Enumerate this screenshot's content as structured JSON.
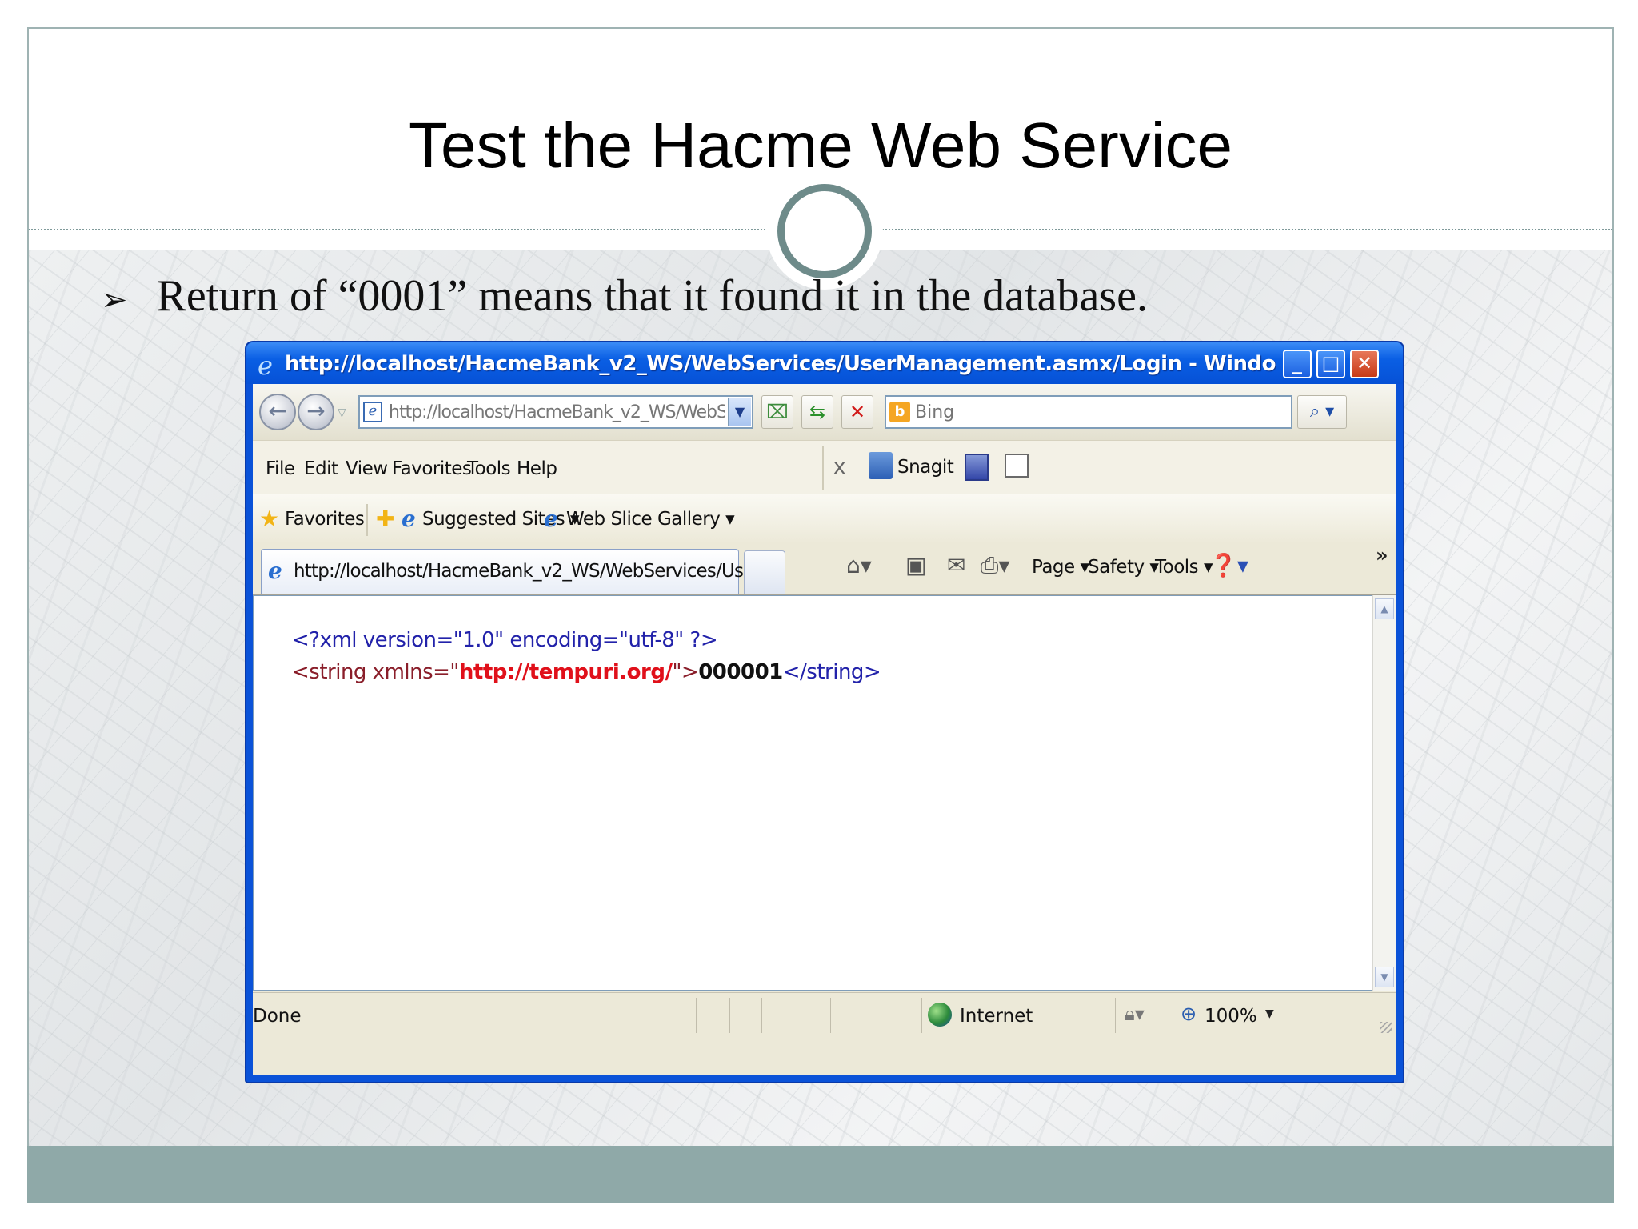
{
  "slide": {
    "title": "Test the Hacme Web Service",
    "bullet": "Return of “0001” means that it found it in the database.",
    "colors": {
      "accent": "#6e8b8a",
      "footer": "#8fa9a8"
    }
  },
  "browser": {
    "window_title": "http://localhost/HacmeBank_v2_WS/WebServices/UserManagement.asmx/Login - Windows Interne...",
    "address": "http://localhost/HacmeBank_v2_WS/WebS",
    "search_placeholder": "Bing",
    "menu": [
      "File",
      "Edit",
      "View",
      "Favorites",
      "Tools",
      "Help"
    ],
    "extensions": {
      "close": "x",
      "snagit": "Snagit"
    },
    "favorites_bar": {
      "favorites": "Favorites",
      "suggested_sites": "Suggested Sites",
      "web_slice_gallery": "Web Slice Gallery"
    },
    "tab_title": "http://localhost/HacmeBank_v2_WS/WebServices/Us...",
    "command_bar": {
      "page": "Page",
      "safety": "Safety",
      "tools": "Tools",
      "more": "»"
    },
    "content": {
      "pi_open": "<?xml version=\"1.0\" encoding=\"utf-8\" ?>",
      "el_open": "<string xmlns=\"",
      "ns": "http://tempuri.org/",
      "el_mid": "\">",
      "value": "000001",
      "el_close": "</string>"
    },
    "status": {
      "text": "Done",
      "zone": "Internet",
      "zoom": "100%"
    },
    "icons": [
      "ie-logo-icon",
      "back-icon",
      "forward-icon",
      "page-icon",
      "refresh-icon",
      "stop-icon",
      "bing-icon",
      "search-icon",
      "snagit-icon",
      "star-icon",
      "home-icon",
      "feeds-icon",
      "mail-icon",
      "print-icon",
      "help-icon",
      "globe-icon",
      "zoom-icon"
    ]
  }
}
